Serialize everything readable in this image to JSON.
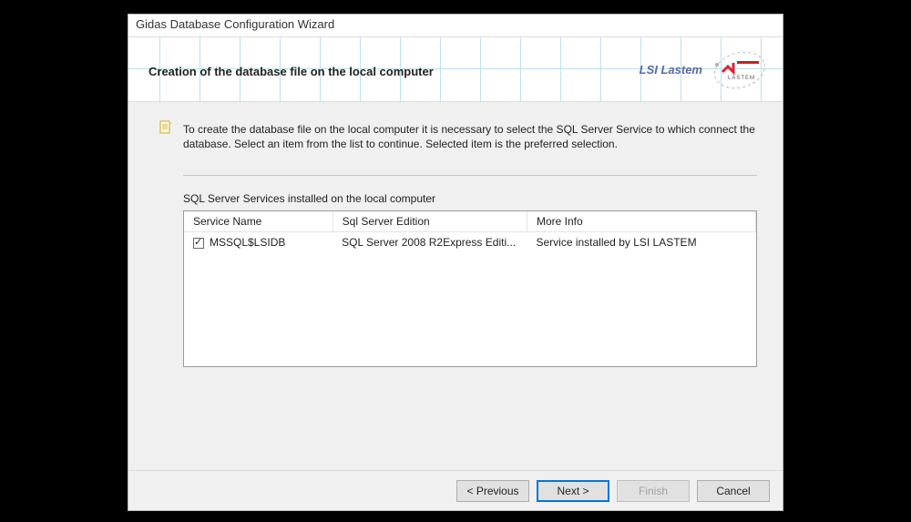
{
  "window": {
    "title": "Gidas Database Configuration Wizard"
  },
  "header": {
    "title": "Creation of the database file on the local computer",
    "brand_text": "LSI Lastem",
    "brand_sub": "LASTEM"
  },
  "body": {
    "note": "To create the database file on the local computer it is necessary to select the SQL Server Service to which connect the database. Select an item from the list to continue. Selected item is the preferred selection.",
    "section_label": "SQL Server Services installed on the local computer",
    "columns": {
      "service_name": "Service Name",
      "sql_edition": "Sql Server Edition",
      "more_info": "More Info"
    },
    "rows": [
      {
        "checked": true,
        "service_name": "MSSQL$LSIDB",
        "sql_edition": "SQL Server 2008 R2Express Editi...",
        "more_info": "Service installed by LSI LASTEM"
      }
    ]
  },
  "buttons": {
    "previous": "< Previous",
    "next": "Next >",
    "finish": "Finish",
    "cancel": "Cancel"
  }
}
